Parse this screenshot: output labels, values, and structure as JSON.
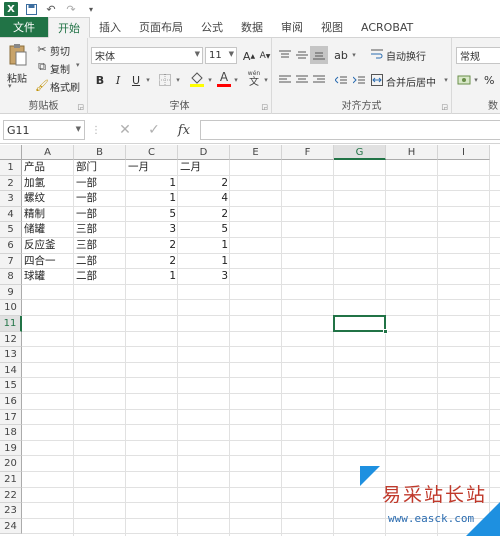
{
  "titlebar": {
    "app_icon": "X",
    "icons": [
      "save-icon",
      "undo-icon",
      "redo-icon",
      "customize-icon"
    ]
  },
  "tabs": [
    "文件",
    "开始",
    "插入",
    "页面布局",
    "公式",
    "数据",
    "审阅",
    "视图",
    "ACROBAT"
  ],
  "active_tab": "开始",
  "ribbon": {
    "clipboard": {
      "paste": "粘贴",
      "cut": "剪切",
      "copy": "复制",
      "format_painter": "格式刷",
      "label": "剪贴板"
    },
    "font": {
      "font_name": "宋体",
      "font_size": "11",
      "grow": "A",
      "shrink": "A",
      "bold": "B",
      "italic": "I",
      "underline": "U",
      "fill_color": "#ffff00",
      "font_color": "#ff0000",
      "font_color_label": "A",
      "phonetic": "wén",
      "label": "字体"
    },
    "alignment": {
      "wrap_text": "自动换行",
      "merge_center": "合并后居中",
      "label": "对齐方式"
    },
    "number": {
      "format": "常规",
      "percent": "%",
      "label": "数"
    }
  },
  "formula_bar": {
    "name_box": "G11",
    "fx": "fx",
    "value": ""
  },
  "grid": {
    "columns": [
      "A",
      "B",
      "C",
      "D",
      "E",
      "F",
      "G",
      "H",
      "I"
    ],
    "selected_column": "G",
    "rows": [
      "1",
      "2",
      "3",
      "4",
      "5",
      "6",
      "7",
      "8",
      "9",
      "10",
      "11",
      "12",
      "13",
      "14",
      "15",
      "16",
      "17",
      "18",
      "19",
      "20",
      "21",
      "22",
      "23",
      "24"
    ],
    "selected_row": "11",
    "data": [
      [
        "产品",
        "部门",
        "一月",
        "二月"
      ],
      [
        "加氢",
        "一部",
        "1",
        "2"
      ],
      [
        "螺纹",
        "一部",
        "1",
        "4"
      ],
      [
        "精制",
        "一部",
        "5",
        "2"
      ],
      [
        "储罐",
        "三部",
        "3",
        "5"
      ],
      [
        "反应釜",
        "三部",
        "2",
        "1"
      ],
      [
        "四合一",
        "二部",
        "2",
        "1"
      ],
      [
        "球罐",
        "二部",
        "1",
        "3"
      ]
    ]
  },
  "watermark": {
    "title": "易采站长站",
    "url": "www.easck.com"
  },
  "colors": {
    "excel_green": "#217346"
  }
}
